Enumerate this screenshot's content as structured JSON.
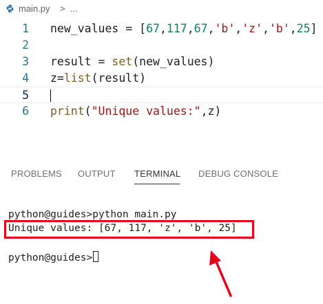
{
  "breadcrumb": {
    "file": "main.py",
    "separator": ">",
    "more": "..."
  },
  "editor": {
    "lines": [
      {
        "number": "1",
        "text": "new_values = [67,117,67,'b','z','b',25]"
      },
      {
        "number": "2",
        "text": ""
      },
      {
        "number": "3",
        "text": "result = set(new_values)"
      },
      {
        "number": "4",
        "text": "z=list(result)"
      },
      {
        "number": "5",
        "text": ""
      },
      {
        "number": "6",
        "text": "print(\"Unique values:\",z)"
      }
    ],
    "current_line": "5"
  },
  "panel": {
    "tabs": [
      {
        "label": "PROBLEMS"
      },
      {
        "label": "OUTPUT"
      },
      {
        "label": "TERMINAL"
      },
      {
        "label": "DEBUG CONSOLE"
      }
    ],
    "active_tab": "TERMINAL"
  },
  "terminal": {
    "command_line": "python@guides>python main.py",
    "output_line": "Unique values: [67, 117, 'z', 'b', 25]",
    "prompt": "python@guides>"
  },
  "colors": {
    "highlight_box": "#e8001a",
    "arrow": "#e8001a",
    "line_number": "#237893",
    "number_literal": "#098658",
    "string_literal": "#a31515",
    "function_name": "#795e26"
  },
  "icons": {
    "file_icon": "python-file-icon",
    "annotation": "red-arrow-icon"
  }
}
